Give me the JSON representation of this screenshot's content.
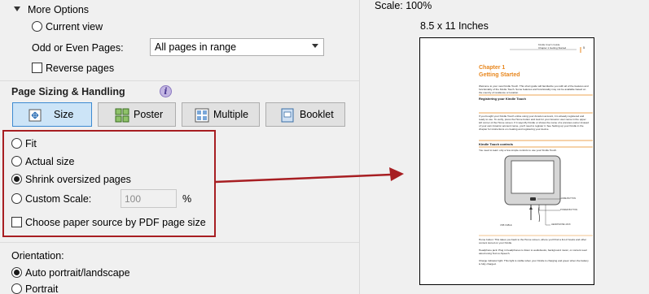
{
  "more_options": {
    "label": "More Options",
    "current_view": "Current view",
    "odd_even_label": "Odd or Even Pages:",
    "odd_even_value": "All pages in range",
    "reverse_pages": "Reverse pages"
  },
  "sizing": {
    "title": "Page Sizing & Handling",
    "buttons": [
      {
        "label": "Size"
      },
      {
        "label": "Poster"
      },
      {
        "label": "Multiple"
      },
      {
        "label": "Booklet"
      }
    ],
    "options": {
      "fit": "Fit",
      "actual_size": "Actual size",
      "shrink": "Shrink oversized pages",
      "custom_scale": "Custom Scale:",
      "custom_scale_value": "100",
      "percent": "%",
      "paper_source": "Choose paper source by PDF page size"
    }
  },
  "orientation": {
    "label": "Orientation:",
    "auto": "Auto portrait/landscape",
    "portrait": "Portrait"
  },
  "preview": {
    "scale": "Scale: 100%",
    "paper_size": "8.5 x 11 Inches",
    "doc": {
      "header_right": "Kindle User's Guide",
      "header_sub": "Chapter 1 Getting Started",
      "page_num": "5",
      "chapter": "Chapter 1",
      "chapter_title": "Getting Started",
      "intro": "Welcome to your new Kindle Touch. This short guide will familiarize you with all of the features and functionality of the Kindle Touch. Some features and functionality may not be available based on the country of residence or location.",
      "heading1": "Registering your Kindle Touch",
      "para1": "If you bought your Kindle Touch online using your Amazon account, it is already registered and ready to use. To verify, press the Home button and look for your Amazon user name in the upper left corner of the Home screen. If it says My Kindle or shows the name of a previous owner instead of your own Amazon account name, you'll need to register it. See Setting up your Kindle in the chapter for instructions on creating and registering your device.",
      "heading2": "Kindle Touch controls",
      "para2": "You need to learn only a few simple controls to use your Kindle Touch.",
      "callout_home": "HOME BUTTON",
      "callout_power": "POWER BUTTON",
      "callout_usb": "USB CABLE",
      "callout_headphone": "HEADPHONE JACK",
      "footer1": "Home button: This takes you back to the Home screen, where you'll find a list of books and other content stored on your Kindle.",
      "footer2": "Headphone jack: Plug in headphones to listen to audiobooks, background music, or content read aloud using Text-to-Speech.",
      "footer3": "Charge indicator light: This light is visible when your Kindle is charging and green when the battery is fully charged."
    }
  },
  "colors": {
    "accent": "#3c8ad1",
    "highlight_box": "#a71e22",
    "doc_orange": "#e8871e"
  }
}
